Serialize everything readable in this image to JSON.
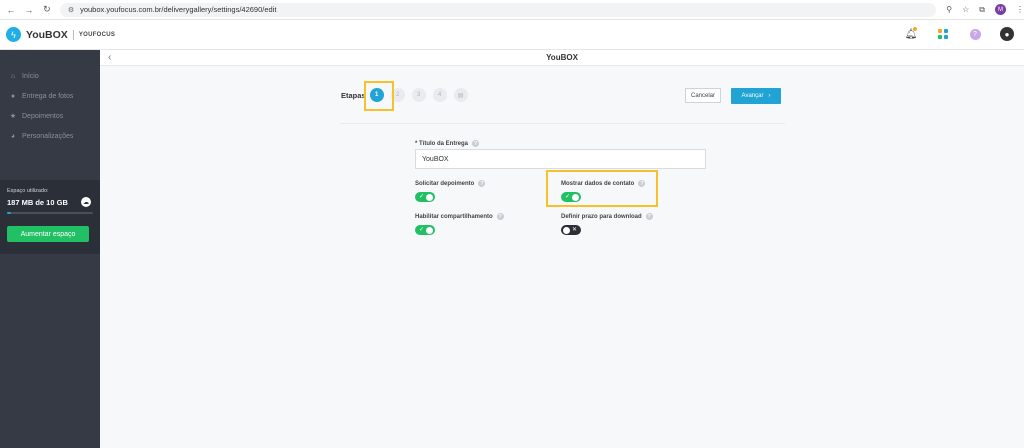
{
  "browser": {
    "url": "youbox.youfocus.com.br/deliverygallery/settings/42690/edit",
    "profile_initial": "M"
  },
  "header": {
    "logo_text": "YouBOX",
    "logo_sub": "YOUFOCUS"
  },
  "sidebar": {
    "items": [
      {
        "label": "Início",
        "icon": "home-icon"
      },
      {
        "label": "Entrega de fotos",
        "icon": "delivery-icon"
      },
      {
        "label": "Depoimentos",
        "icon": "star-icon"
      },
      {
        "label": "Personalizações",
        "icon": "palette-icon"
      }
    ],
    "storage_label": "Espaço utilizado:",
    "storage_value": "187 MB de 10 GB",
    "storage_fraction": 0.0183,
    "upgrade_label": "Aumentar espaço"
  },
  "main": {
    "title": "YouBOX",
    "steps_label": "Etapas",
    "steps": [
      {
        "label": "1",
        "active": true
      },
      {
        "label": "2",
        "active": false
      },
      {
        "label": "3",
        "active": false
      },
      {
        "label": "4",
        "active": false
      },
      {
        "label": "",
        "active": false,
        "icon": "document-icon"
      }
    ],
    "cancel_label": "Cancelar",
    "next_label": "Avançar"
  },
  "form": {
    "title_label": "* Título da Entrega",
    "title_value": "YouBOX",
    "testimonial_label": "Solicitar depoimento",
    "testimonial_on": true,
    "contact_label": "Mostrar dados de contato",
    "contact_on": true,
    "share_label": "Habilitar compartilhamento",
    "share_on": true,
    "deadline_label": "Definir prazo para download",
    "deadline_on": false
  },
  "colors": {
    "accent": "#21a3d4",
    "success": "#22c065",
    "sidebar": "#353a45",
    "highlight": "#f6c12b"
  }
}
